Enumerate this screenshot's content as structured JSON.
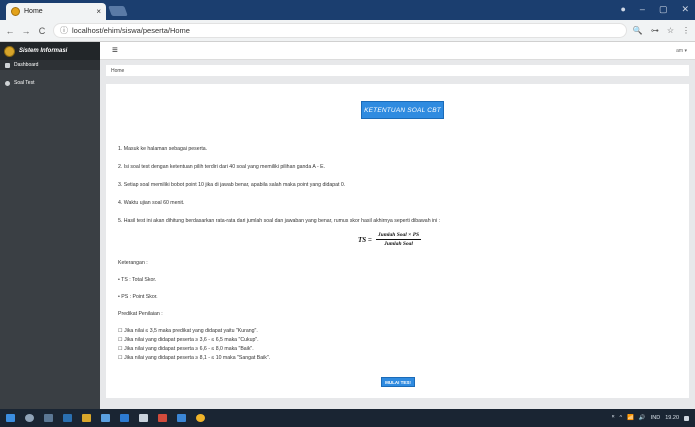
{
  "browser": {
    "tab_title": "Home",
    "tab_close": "×",
    "url": "localhost/ehim/siswa/peserta/Home",
    "back_glyph": "←",
    "forward_glyph": "→",
    "reload_glyph": "C",
    "info_glyph": "ⓘ",
    "window_controls": [
      "●",
      "–",
      "▢",
      "✕"
    ],
    "addr_icons": [
      "🔍",
      "⊶",
      "☆",
      "⋮"
    ]
  },
  "sidebar": {
    "brand": "Sistem Informasi",
    "items": [
      {
        "label": "Dashboard",
        "icon": "monitor-icon"
      },
      {
        "label": "Soal Test",
        "icon": "circle-icon"
      }
    ]
  },
  "topbar": {
    "hamburger": "≡",
    "user_menu": "am ▾"
  },
  "breadcrumb": "Home",
  "content": {
    "title_button": "KETENTUAN SOAL CBT",
    "rules": [
      "1. Masuk ke halaman sebagai peserta.",
      "2. Isi soal test dengan ketentuan pilih terdiri dari 40 soal yang memiliki pilihan ganda A - E.",
      "3. Setiap soal memiliki bobot point 10 jika di jawab benar, apabila salah maka point yang didapat 0.",
      "4. Waktu ujian soal 60 menit.",
      "5. Hasil test ini akan dihitung berdasarkan rata-rata dari jumlah soal dan jawaban yang benar, rumus skor hasil akhirnya seperti dibawah ini :"
    ],
    "formula_lhs": "TS =",
    "formula_numerator": "Jumlah Soal × PS",
    "formula_denominator": "Jumlah Soal",
    "keterangan_label": "Keterangan :",
    "ts_def": "• TS : Total Skor.",
    "ps_def": "• PS : Point Skor.",
    "predikat_label": "Predikat Penilaian :",
    "predikat": [
      "☐ Jika nilai ≤ 3,5 maka predikat yang didapat yaitu \"Kurang\".",
      "☐ Jika nilai yang didapat peserta ≥ 3,6 - ≤ 6,5 maka \"Cukup\".",
      "☐ Jika nilai yang didapat peserta ≥ 6,6 - ≤ 8,0 maka \"Baik\".",
      "☐ Jika nilai yang didapat peserta ≥ 8,1 - ≤ 10 maka \"Sangat Baik\"."
    ],
    "start_button": "MULAI TES!"
  },
  "taskbar": {
    "tray_text": [
      "ᴿ",
      "^",
      "📶",
      "🔊",
      "IND",
      "19.20"
    ]
  },
  "colors": {
    "accent": "#2f8be0",
    "sidebar": "#3a3f44",
    "tabbar": "#1b3e6f",
    "taskbar": "#1a2533"
  }
}
